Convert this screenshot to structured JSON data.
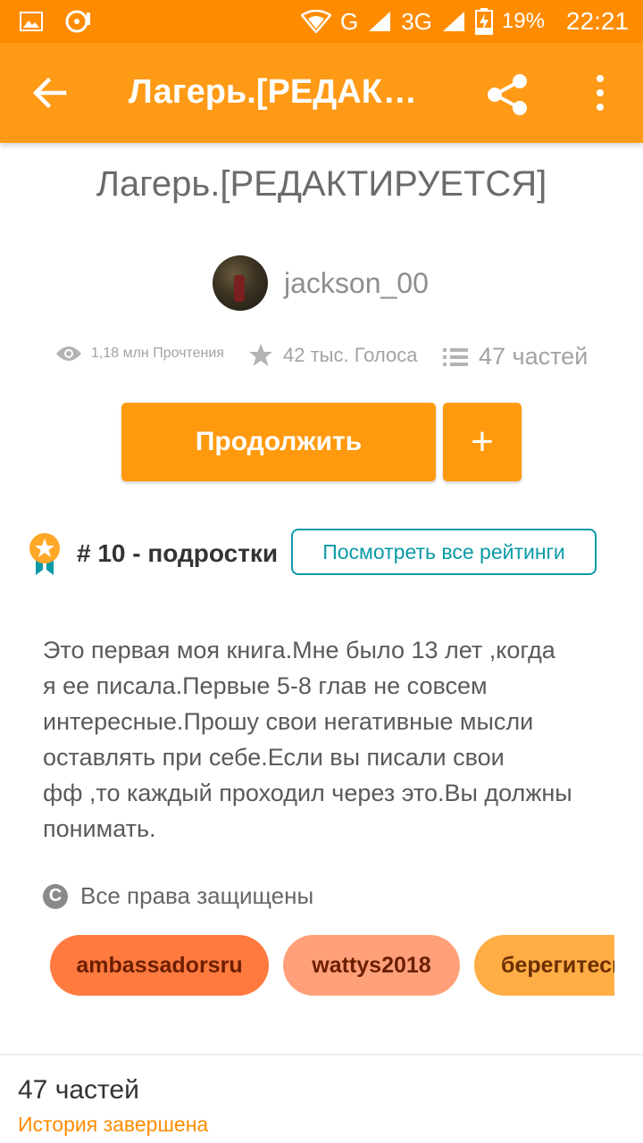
{
  "status_bar": {
    "icons": [
      "image-icon",
      "media-icon",
      "wifi-icon",
      "signal-g-icon",
      "signal-3g-icon",
      "battery-charging-icon"
    ],
    "network_g": "G",
    "network_3g": "3G",
    "battery": "19%",
    "time": "22:21"
  },
  "appbar": {
    "title": "Лагерь.[РЕДАКТИРУЕТСЯ]"
  },
  "story": {
    "title": "Лагерь.[РЕДАКТИРУЕТСЯ]",
    "author": "jackson_00",
    "reads": "1,18 млн Прочтения",
    "votes": "42 тыс. Голоса",
    "parts": "47 частей",
    "continue_label": "Продолжить",
    "add_label": "+",
    "rank": "# 10 - подростки",
    "rankings_button": "Посмотреть все рейтинги",
    "description_lines": [
      "Это первая моя книга.Мне было 13 лет ,когда",
      "я ее писала.Первые 5-8 глав не совсем",
      "интересные.Прошу свои негативные мысли",
      "оставлять при себе.Если вы писали свои",
      "фф ,то каждый проходил через это.Вы должны",
      "понимать."
    ],
    "copyright_symbol": "C",
    "copyright": "Все права защищены",
    "tags": [
      {
        "label": "ambassadorsru",
        "bg": "#ff7a3f",
        "fg": "#6b1f00"
      },
      {
        "label": "wattys2018",
        "bg": "#ffa07a",
        "fg": "#6b1f00"
      },
      {
        "label": "берегитесь",
        "bg": "#ffad45",
        "fg": "#6b2f00"
      }
    ]
  },
  "footer": {
    "parts_count": "47 частей",
    "status": "История завершена"
  },
  "colors": {
    "status_bar": "#ff8c00",
    "app_bar": "#ff9a16",
    "accent": "#ff9a0e",
    "teal": "#0a9aa6"
  }
}
